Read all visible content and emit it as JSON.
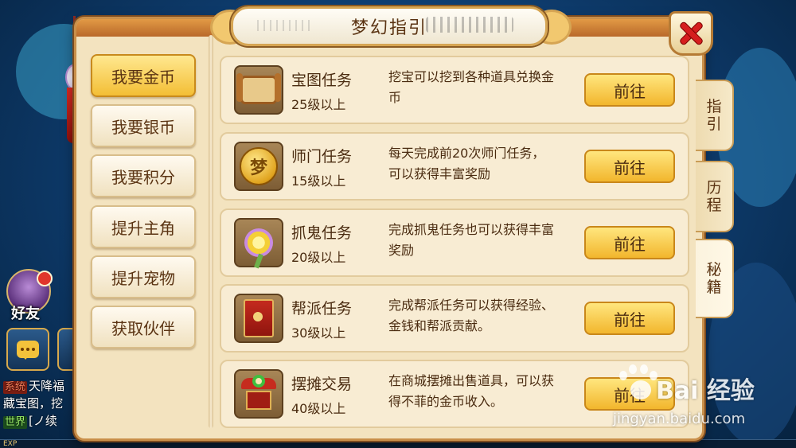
{
  "window": {
    "title": "梦幻指引"
  },
  "left_menu": [
    {
      "label": "我要金币",
      "active": true
    },
    {
      "label": "我要银币",
      "active": false
    },
    {
      "label": "我要积分",
      "active": false
    },
    {
      "label": "提升主角",
      "active": false
    },
    {
      "label": "提升宠物",
      "active": false
    },
    {
      "label": "获取伙伴",
      "active": false
    }
  ],
  "tasks": [
    {
      "name": "宝图任务",
      "level": "25级以上",
      "desc": "挖宝可以挖到各种道具兑换金币",
      "button": "前往",
      "icon": "treasure-map-icon"
    },
    {
      "name": "师门任务",
      "level": "15级以上",
      "desc": "每天完成前20次师门任务，可以获得丰富奖励",
      "button": "前往",
      "icon": "gold-coin-icon"
    },
    {
      "name": "抓鬼任务",
      "level": "20级以上",
      "desc": "完成抓鬼任务也可以获得丰富奖励",
      "button": "前往",
      "icon": "flower-wand-icon"
    },
    {
      "name": "帮派任务",
      "level": "30级以上",
      "desc": "完成帮派任务可以获得经验、金钱和帮派贡献。",
      "button": "前往",
      "icon": "guild-banner-icon"
    },
    {
      "name": "摆摊交易",
      "level": "40级以上",
      "desc": "在商城摆摊出售道具，可以获得不菲的金币收入。",
      "button": "前往",
      "icon": "market-stall-icon"
    }
  ],
  "side_tabs": [
    {
      "label": [
        "指",
        "引"
      ],
      "active": false
    },
    {
      "label": [
        "历",
        "程"
      ],
      "active": false
    },
    {
      "label": [
        "秘",
        "籍"
      ],
      "active": true
    }
  ],
  "hud": {
    "friend_label": "好友",
    "chat": {
      "line1_tag": "系统",
      "line1_text": "天降福",
      "line2_text": "藏宝图，挖",
      "line3_tag": "世界",
      "line3_text": "[ノ续",
      "exp_label": "EXP"
    }
  },
  "watermark": {
    "brand": "Bai 经验",
    "url": "jingyan.baidu.com"
  },
  "colors": {
    "accent_gold": "#f2b62d",
    "panel_bg": "#f3e3bf",
    "close_red": "#d51e1e"
  }
}
